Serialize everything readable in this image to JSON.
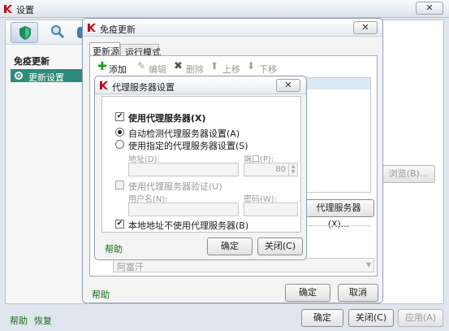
{
  "settings": {
    "title": "设置",
    "section_title": "免疫更新",
    "selected_item": "更新设置",
    "icons": [
      "shield-icon",
      "search-icon"
    ],
    "browse_button": "浏览(B)...",
    "footer": {
      "help": "帮助",
      "restore": "恢复",
      "ok": "确定",
      "close": "关闭(C)",
      "apply": "应用(A)"
    }
  },
  "update_dialog": {
    "title": "免疫更新",
    "tabs": [
      "更新源",
      "运行模式"
    ],
    "toolbar": {
      "add": "添加",
      "edit": "编辑",
      "delete": "删除",
      "up": "上移",
      "down": "下移"
    },
    "proxy_button": "代理服务器(X)...",
    "combo_value": "阿富汗",
    "help": "帮助",
    "ok": "确定",
    "cancel": "取消"
  },
  "proxy_dialog": {
    "title": "代理服务器设置",
    "use_proxy": "使用代理服务器(X)",
    "auto_detect": "自动检测代理服务器设置(A)",
    "use_specified": "使用指定的代理服务器设置(S)",
    "address_label": "地址(D):",
    "port_label": "端口(P):",
    "port_value": "80",
    "use_auth": "使用代理服务器验证(U)",
    "username_label": "用户名(N):",
    "password_label": "密码(W):",
    "bypass_local": "本地地址不使用代理服务器(B)",
    "help": "帮助",
    "ok": "确定",
    "close": "关闭(C)",
    "use_proxy_checked": true,
    "bypass_local_checked": true,
    "mode_selected": "auto"
  },
  "colors": {
    "accent_green": "#1a6b1a",
    "selected_item_bg": "#2e8b7a",
    "kaspersky_red": "#c4001a"
  }
}
